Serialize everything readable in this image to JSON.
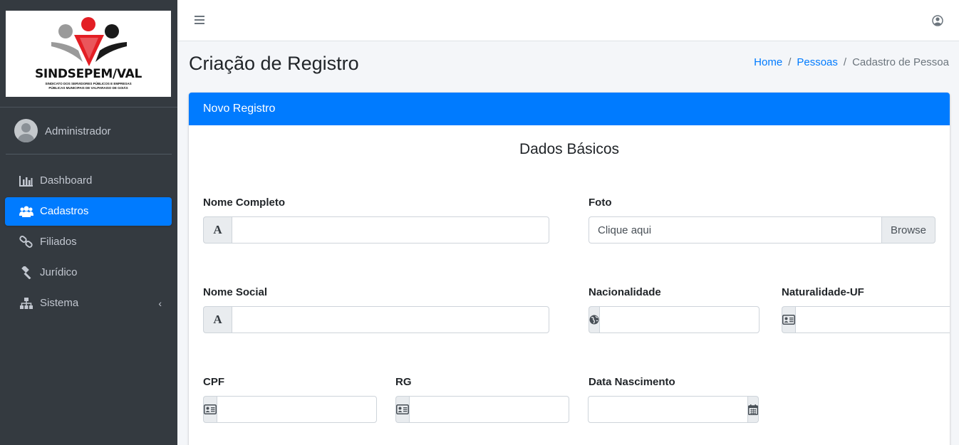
{
  "brand": {
    "name": "SINDSEPEM/VAL",
    "tagline1": "SINDICATO DOS SERVIDORES PÚBLICOS E EMPRESAS",
    "tagline2": "PÚBLICAS MUNICIPAIS DE VALPARAISO DE GOIÁS"
  },
  "user": {
    "name": "Administrador"
  },
  "sidebar": {
    "items": [
      {
        "label": "Dashboard",
        "icon": "bar-chart-icon",
        "active": false
      },
      {
        "label": "Cadastros",
        "icon": "users-icon",
        "active": true
      },
      {
        "label": "Filiados",
        "icon": "link-icon",
        "active": false
      },
      {
        "label": "Jurídico",
        "icon": "gavel-icon",
        "active": false
      },
      {
        "label": "Sistema",
        "icon": "sitemap-icon",
        "active": false,
        "chevron": "‹"
      }
    ]
  },
  "header": {
    "title": "Criação de Registro",
    "breadcrumb": {
      "home": "Home",
      "pessoas": "Pessoas",
      "current": "Cadastro de Pessoa",
      "separator": "/"
    }
  },
  "card": {
    "title": "Novo Registro",
    "section": "Dados Básicos"
  },
  "form": {
    "nome_completo": {
      "label": "Nome Completo",
      "value": "",
      "addon": "A"
    },
    "foto": {
      "label": "Foto",
      "placeholder": "Clique aqui",
      "button": "Browse"
    },
    "nome_social": {
      "label": "Nome Social",
      "value": "",
      "addon": "A"
    },
    "nacionalidade": {
      "label": "Nacionalidade",
      "value": ""
    },
    "naturalidade": {
      "label": "Naturalidade-UF",
      "value": ""
    },
    "cpf": {
      "label": "CPF",
      "value": ""
    },
    "rg": {
      "label": "RG",
      "value": ""
    },
    "data_nascimento": {
      "label": "Data Nascimento",
      "value": ""
    }
  },
  "colors": {
    "primary": "#007bff",
    "sidebar": "#343a40",
    "logo_red": "#e31e24"
  }
}
